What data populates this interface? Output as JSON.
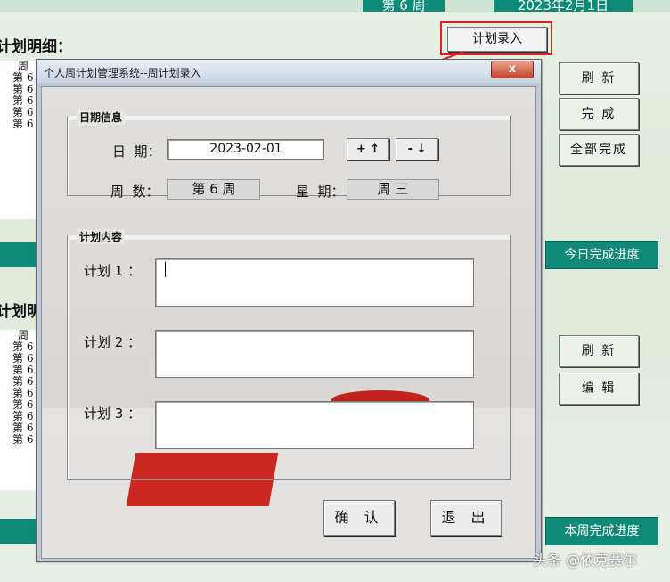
{
  "header": {
    "week_chip": "第 6 周",
    "date_chip": "2023年2月1日",
    "plan_entry_button": "计划录入"
  },
  "sheet": {
    "section1_title": "计划明细：",
    "section2_title": "计划明",
    "list1_header": "周",
    "list1_items": [
      "第 6",
      "第 6",
      "第 6",
      "第 6",
      "第 6"
    ],
    "list2_header": "周",
    "list2_items": [
      "第 6",
      "第 6",
      "第 6",
      "第 6",
      "第 6",
      "第 6",
      "第 6",
      "第 6",
      "第 6"
    ],
    "right_buttons_top": [
      "刷 新",
      "完 成",
      "全部完成"
    ],
    "right_buttons_mid": [
      "刷 新",
      "编 辑"
    ],
    "today_progress_label": "今日完成进度",
    "week_progress_label": "本周完成进度",
    "watermark": "头条 @依克赛尔"
  },
  "dialog": {
    "title": "个人周计划管理系统--周计划录入",
    "close_symbol": "x",
    "date_group": {
      "label": "日期信息",
      "date_label": "日  期：",
      "date_value": "2023-02-01",
      "plus_button": "+ ↑",
      "minus_button": "- ↓",
      "week_label": "周  数：",
      "week_value": "第 6 周",
      "weekday_label": "星  期：",
      "weekday_value": "周 三"
    },
    "plan_group": {
      "label": "计划内容",
      "plan1_label": "计划 1 ：",
      "plan2_label": "计划 2 ：",
      "plan3_label": "计划 3 ：",
      "plan1_value": "",
      "plan2_value": "",
      "plan3_value": ""
    },
    "confirm_button": "确 认",
    "exit_button": "退 出"
  },
  "colors": {
    "teal": "#0f8a78",
    "highlight_red": "#e02020",
    "close_red": "#c6442e"
  }
}
